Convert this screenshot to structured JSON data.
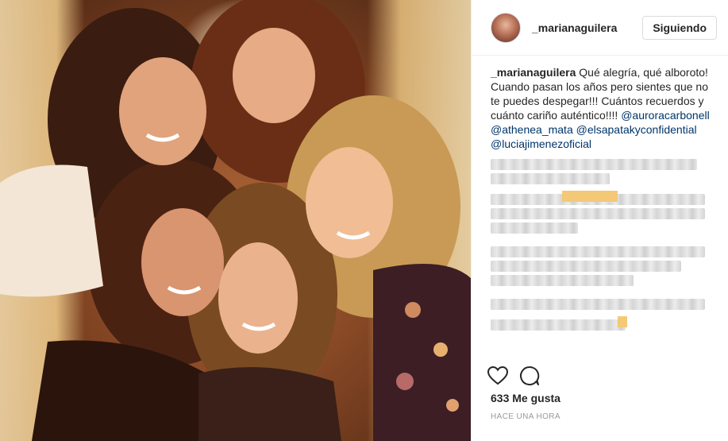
{
  "photo": {
    "alt": ""
  },
  "header": {
    "username": "_marianaguilera",
    "follow_label": "Siguiendo"
  },
  "caption": {
    "username": "_marianaguilera",
    "text": "Qué alegría, qué alboroto! Cuando pasan los años pero sientes que no te puedes despegar!!! Cuántos recuerdos y cuánto cariño auténtico!!!!",
    "mentions": [
      "@auroracarbonell",
      "@athenea_mata",
      "@elsapatakyconfidential",
      "@luciajimenezoficial"
    ]
  },
  "actions": {
    "like_icon": "heart-icon",
    "comment_icon": "comment-icon"
  },
  "likes": "633 Me gusta",
  "timestamp": "HACE UNA HORA",
  "colors": {
    "accent": "#003569",
    "text": "#262626",
    "muted": "#999999",
    "border": "#efefef"
  }
}
